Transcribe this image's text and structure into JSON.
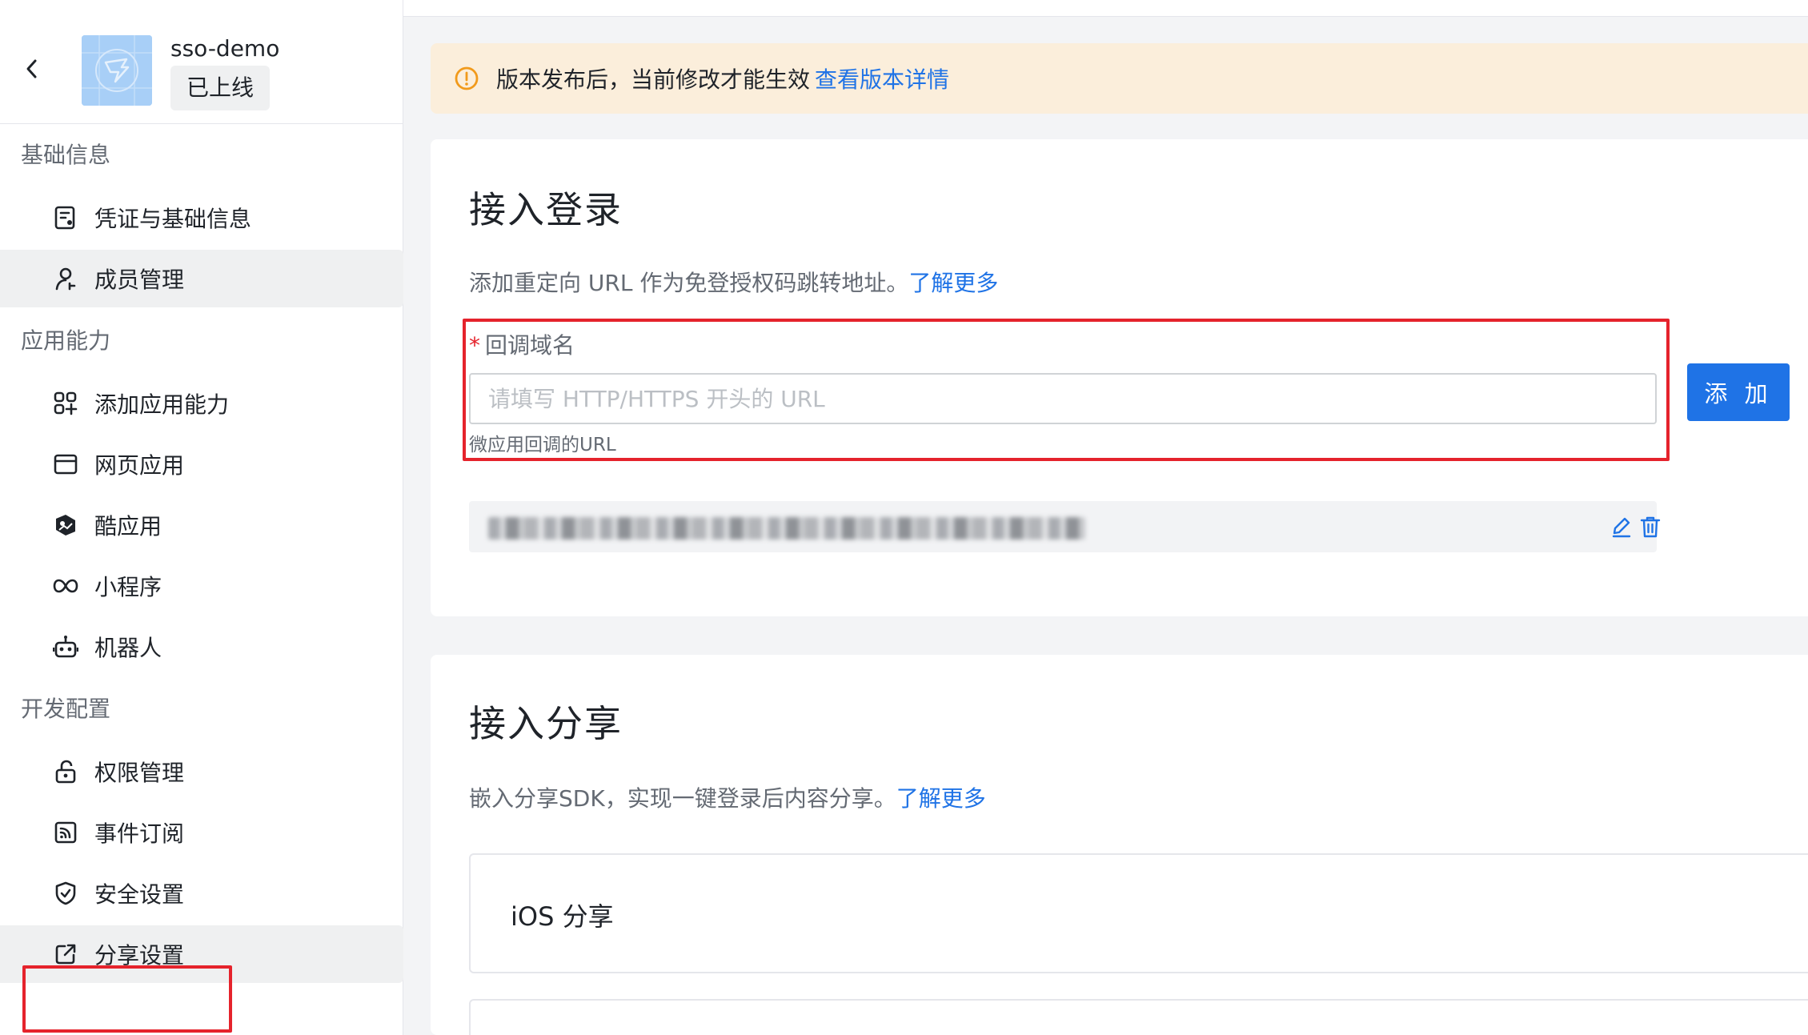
{
  "app": {
    "name": "sso-demo",
    "status": "已上线"
  },
  "sidebar": {
    "groups": [
      {
        "title": "基础信息",
        "items": [
          {
            "label": "凭证与基础信息",
            "icon": "credential-icon"
          },
          {
            "label": "成员管理",
            "icon": "user-icon",
            "active": true
          }
        ]
      },
      {
        "title": "应用能力",
        "items": [
          {
            "label": "添加应用能力",
            "icon": "apps-add-icon"
          },
          {
            "label": "网页应用",
            "icon": "browser-icon"
          },
          {
            "label": "酷应用",
            "icon": "cool-app-icon"
          },
          {
            "label": "小程序",
            "icon": "mini-program-icon"
          },
          {
            "label": "机器人",
            "icon": "robot-icon"
          }
        ]
      },
      {
        "title": "开发配置",
        "items": [
          {
            "label": "权限管理",
            "icon": "unlock-icon"
          },
          {
            "label": "事件订阅",
            "icon": "rss-icon"
          },
          {
            "label": "安全设置",
            "icon": "shield-icon"
          },
          {
            "label": "分享设置",
            "icon": "share-external-icon",
            "active": true
          }
        ]
      }
    ]
  },
  "notice": {
    "text": "版本发布后，当前修改才能生效",
    "link": "查看版本详情",
    "icon": "warning-circle-icon"
  },
  "login_card": {
    "title": "接入登录",
    "desc": "添加重定向 URL 作为免登授权码跳转地址。",
    "learn_more": "了解更多",
    "field_label": "回调域名",
    "required_mark": "*",
    "input_placeholder": "请填写 HTTP/HTTPS 开头的 URL",
    "input_value": "",
    "field_help": "微应用回调的URL",
    "add_button": "添 加"
  },
  "share_card": {
    "title": "接入分享",
    "desc": "嵌入分享SDK，实现一键登录后内容分享。",
    "learn_more": "了解更多",
    "ios_title": "iOS 分享"
  },
  "colors": {
    "accent": "#1f73e6",
    "highlight": "#e5232c",
    "notice_bg": "#fbeedb",
    "active_bg": "#eff0f1"
  }
}
